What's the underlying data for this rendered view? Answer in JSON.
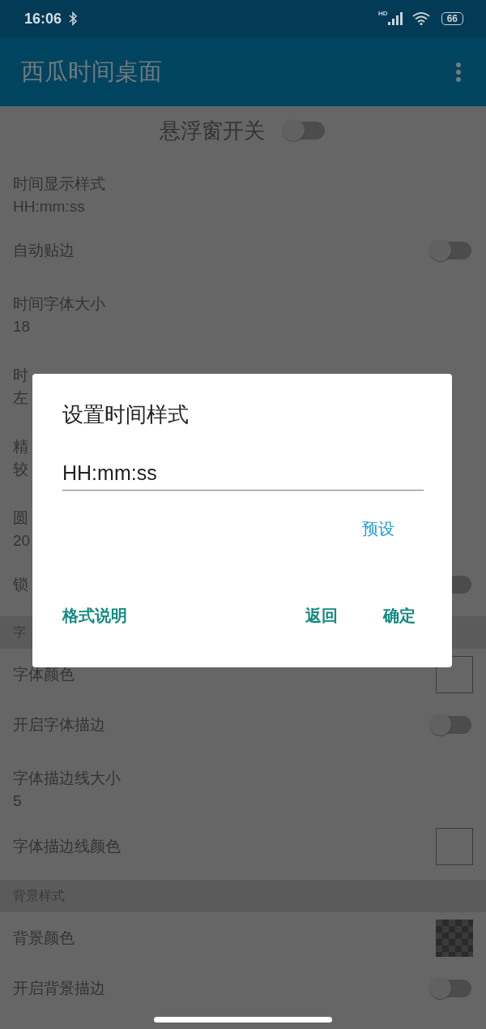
{
  "status_bar": {
    "time": "16:06",
    "network_label": "HD",
    "battery": "66"
  },
  "app_bar": {
    "title": "西瓜时间桌面"
  },
  "rows": [
    {
      "kind": "header",
      "title": "悬浮窗开关",
      "on": false
    },
    {
      "kind": "value",
      "title": "时间显示样式",
      "value": "HH:mm:ss"
    },
    {
      "kind": "toggle",
      "title": "自动贴边",
      "on": false
    },
    {
      "kind": "value",
      "title": "时间字体大小",
      "value": "18"
    },
    {
      "kind": "value",
      "title": "时",
      "value": "左"
    },
    {
      "kind": "value",
      "title": "精",
      "value": "较"
    },
    {
      "kind": "value",
      "title": "圆",
      "value": "20"
    },
    {
      "kind": "toggle",
      "title": "锁",
      "on": false
    },
    {
      "kind": "section",
      "title": "字"
    },
    {
      "kind": "swatch",
      "title": "字体颜色"
    },
    {
      "kind": "toggle",
      "title": "开启字体描边",
      "on": false
    },
    {
      "kind": "value",
      "title": "字体描边线大小",
      "value": "5"
    },
    {
      "kind": "swatch",
      "title": "字体描边线颜色"
    },
    {
      "kind": "section",
      "title": "背景样式"
    },
    {
      "kind": "checker_swatch",
      "title": "背景颜色"
    },
    {
      "kind": "toggle",
      "title": "开启背景描边",
      "on": false
    }
  ],
  "dialog": {
    "title": "设置时间样式",
    "input_value": "HH:mm:ss",
    "preset_button": "预设",
    "help_button": "格式说明",
    "cancel_button": "返回",
    "ok_button": "确定"
  }
}
